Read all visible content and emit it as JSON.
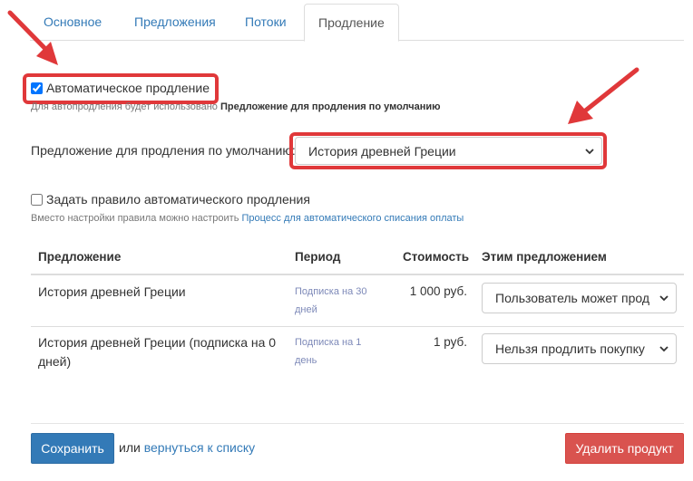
{
  "tabs": [
    {
      "label": "Основное"
    },
    {
      "label": "Предложения"
    },
    {
      "label": "Потоки"
    },
    {
      "label": "Продление"
    }
  ],
  "auto_renewal": {
    "checkbox_label": "Автоматическое продление",
    "checked": true,
    "hint_prefix": "Для автопродления будет использовано ",
    "hint_bold": "Предложение для продления по умолчанию"
  },
  "default_offer": {
    "label": "Предложение для продления по умолчанию:",
    "selected": "История древней Греции"
  },
  "rule": {
    "checkbox_label": "Задать правило автоматического продления",
    "checked": false,
    "hint_prefix": "Вместо настройки правила можно настроить ",
    "hint_link": "Процесс для автоматического списания оплаты"
  },
  "table": {
    "headers": {
      "offer": "Предложение",
      "period": "Период",
      "price": "Стоимость",
      "action": "Этим предложением"
    },
    "rows": [
      {
        "offer": "История древней Греции",
        "period": "Подписка на 30 дней",
        "price": "1 000 руб.",
        "action": "Пользователь может прод"
      },
      {
        "offer": "История древней Греции (подписка на 0 дней)",
        "period": "Подписка на 1 день",
        "price": "1 руб.",
        "action": "Нельзя продлить покупку"
      }
    ]
  },
  "footer": {
    "save_label": "Сохранить",
    "or_label": "или",
    "back_link": "вернуться к списку",
    "delete_label": "Удалить продукт"
  },
  "colors": {
    "accent": "#337ab7",
    "danger": "#d9534f",
    "highlight": "#e0383a"
  }
}
